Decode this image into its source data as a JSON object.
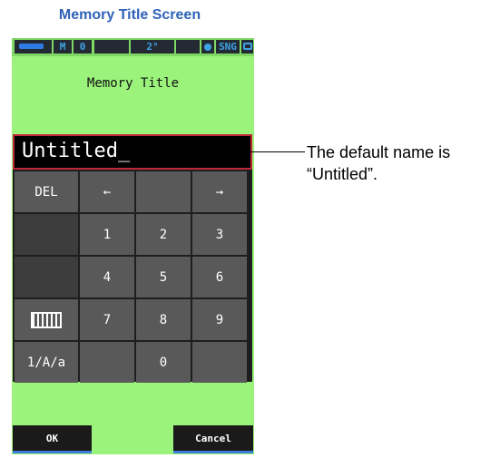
{
  "caption": "Memory Title Screen",
  "status_bar": {
    "mode": "M",
    "memory_count": "0",
    "angle": "2°",
    "measure_mode": "SNG"
  },
  "title": "Memory Title",
  "input": {
    "value": "Untitled_"
  },
  "keypad": {
    "del": "DEL",
    "left": "←",
    "right": "→",
    "digits": [
      "1",
      "2",
      "3",
      "4",
      "5",
      "6",
      "7",
      "8",
      "9",
      "0"
    ],
    "mode": "1/A/a"
  },
  "buttons": {
    "ok": "OK",
    "cancel": "Cancel"
  },
  "callout": {
    "line1": "The default name is",
    "line2": "“Untitled”."
  },
  "colors": {
    "screen_bg": "#9cf37c",
    "caption": "#2f63b8",
    "input_border": "#c0283a",
    "key": "#595959",
    "status_text": "#3fa2e6"
  },
  "icons": [
    "battery-icon",
    "measurement-dot-icon",
    "lock-icon",
    "keyboard-icon",
    "left-arrow-icon",
    "right-arrow-icon"
  ]
}
